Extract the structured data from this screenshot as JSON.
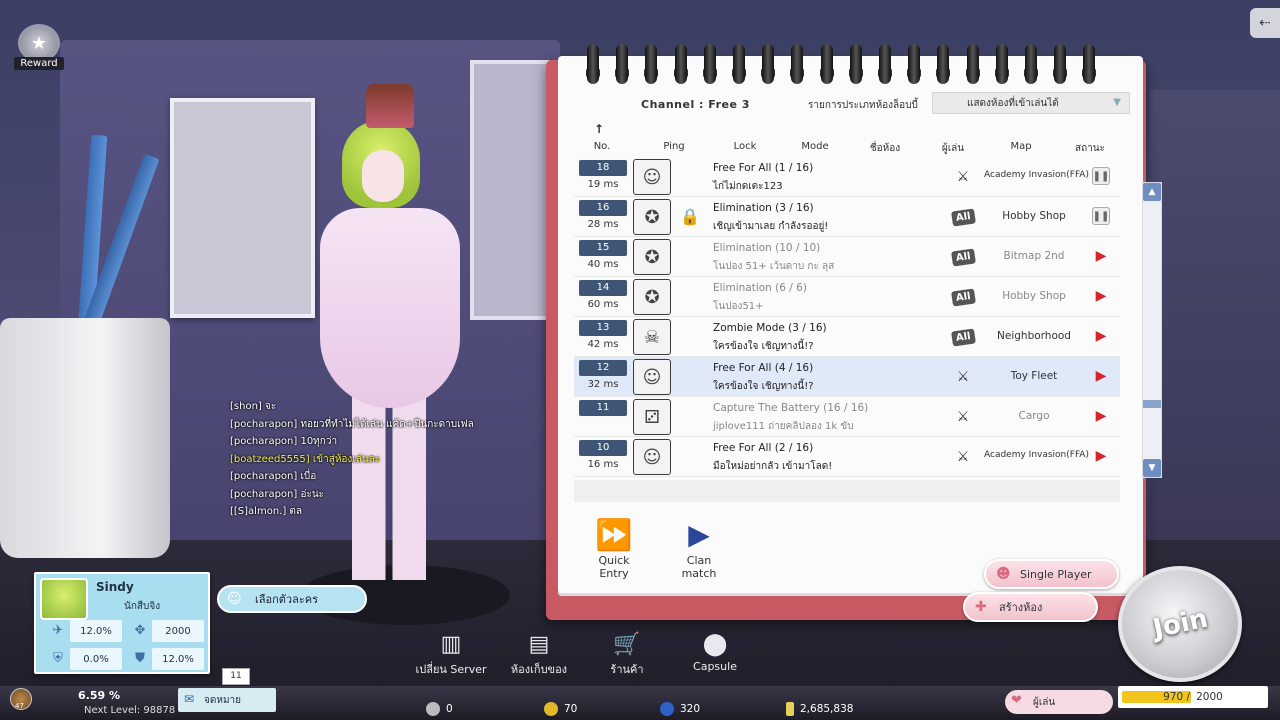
{
  "reward": {
    "label": "Reward"
  },
  "chat": [
    {
      "text": "[shon] จะ",
      "highlight": false
    },
    {
      "text": "[pocharapon] ทอยวที่ทำไมได้เล่น แค้ด+ปืนกะดาบเฟล",
      "highlight": false
    },
    {
      "text": "[pocharapon] 10ทุกว่า",
      "highlight": false
    },
    {
      "text": "[boatzeed5555] เข้าสู่ห้องเล่นละ",
      "highlight": true
    },
    {
      "text": "[pocharapon] เบื่อ",
      "highlight": false
    },
    {
      "text": "[pocharapon] อ่ะนะ",
      "highlight": false
    },
    {
      "text": "[[S]almon.] ตล",
      "highlight": false
    }
  ],
  "lobby": {
    "channel": "Channel : Free 3",
    "room_type_label": "รายการประเภทห้องล็อบบี้",
    "room_filter": "แสดงห้องที่เข้าเล่นได้",
    "headers": {
      "no": "No.",
      "ping": "Ping",
      "lock": "Lock",
      "mode": "Mode",
      "room": "ชื่อห้อง",
      "players": "ผู้เล่น",
      "map": "Map",
      "status": "สถานะ"
    },
    "rooms": [
      {
        "no": "18",
        "ping": "19 ms",
        "mode": "Free For All (1 / 16)",
        "name": "ไก่ไม่กดเตะ123",
        "map": "Academy Invasion(FFA)",
        "map_icon": "weapon",
        "status": "pause",
        "locked": false,
        "dim": false,
        "selected": false
      },
      {
        "no": "16",
        "ping": "28 ms",
        "mode": "Elimination (3 / 16)",
        "name": "เชิญเข้ามาเลย กำลังรออยู่!",
        "map": "Hobby Shop",
        "map_icon": "all",
        "status": "pause",
        "locked": true,
        "dim": false,
        "selected": false
      },
      {
        "no": "15",
        "ping": "40 ms",
        "mode": "Elimination (10 / 10)",
        "name": "โนปอง 51+ เว้นดาบ กะ ลุส",
        "map": "Bitmap 2nd",
        "map_icon": "all",
        "status": "play",
        "locked": false,
        "dim": true,
        "selected": false
      },
      {
        "no": "14",
        "ping": "60 ms",
        "mode": "Elimination (6 / 6)",
        "name": "โนปอง51+",
        "map": "Hobby Shop",
        "map_icon": "all",
        "status": "play",
        "locked": false,
        "dim": true,
        "selected": false
      },
      {
        "no": "13",
        "ping": "42 ms",
        "mode": "Zombie Mode (3 / 16)",
        "name": "ใครข้องใจ เชิญทางนี้!?",
        "map": "Neighborhood",
        "map_icon": "all",
        "status": "play",
        "locked": false,
        "dim": false,
        "selected": false
      },
      {
        "no": "12",
        "ping": "32 ms",
        "mode": "Free For All (4 / 16)",
        "name": "ใครข้องใจ เชิญทางนี้!?",
        "map": "Toy Fleet",
        "map_icon": "weapon",
        "status": "play",
        "locked": false,
        "dim": false,
        "selected": true
      },
      {
        "no": "11",
        "ping": "",
        "mode": "Capture The Battery (16 / 16)",
        "name": "jiplove111 ถ่ายคลิปลอง 1k ขับ",
        "map": "Cargo",
        "map_icon": "weapon",
        "status": "play",
        "locked": false,
        "dim": true,
        "selected": false
      },
      {
        "no": "10",
        "ping": "16 ms",
        "mode": "Free For All (2 / 16)",
        "name": "มือใหม่อย่ากลัว เข้ามาโลด!",
        "map": "Academy Invasion(FFA)",
        "map_icon": "weapon",
        "status": "play",
        "locked": false,
        "dim": false,
        "selected": false
      }
    ],
    "quick_entry": "Quick Entry",
    "clan_match": "Clan match",
    "single_player": "Single Player",
    "create_room": "สร้างห้อง",
    "join": "Join"
  },
  "profile": {
    "name": "Sindy",
    "rank": "นักสืบจิง",
    "stats": {
      "s1": "12.0%",
      "s2": "2000",
      "s3": "0.0%",
      "s4": "12.0%"
    },
    "select_character": "เลือกตัวละคร"
  },
  "nav": [
    {
      "label": "เปลี่ยน Server",
      "icon": "server-icon",
      "glyph": "▥"
    },
    {
      "label": "ห้องเก็บของ",
      "icon": "storage-icon",
      "glyph": "▤"
    },
    {
      "label": "ร้านค้า",
      "icon": "shop-cart-icon",
      "glyph": "🛒"
    },
    {
      "label": "Capsule",
      "icon": "capsule-icon",
      "glyph": "⬤"
    }
  ],
  "status_bar": {
    "level": "47",
    "exp_percent": "6.59 %",
    "next_level": "Next Level: 98878",
    "mail_label": "จดหมาย",
    "mail_count": "11",
    "currency_1": "0",
    "currency_2": "70",
    "currency_3": "320",
    "currency_4": "2,685,838",
    "players_label": "ผู้เล่น",
    "stamina_current": "970 /",
    "stamina_max": "2000",
    "stamina_fraction": 0.485
  },
  "colors": {
    "accent_blue": "#29479a",
    "play_red": "#d8232a",
    "notebook_red": "#c85a64",
    "selected_row": "#dfe9f7"
  }
}
